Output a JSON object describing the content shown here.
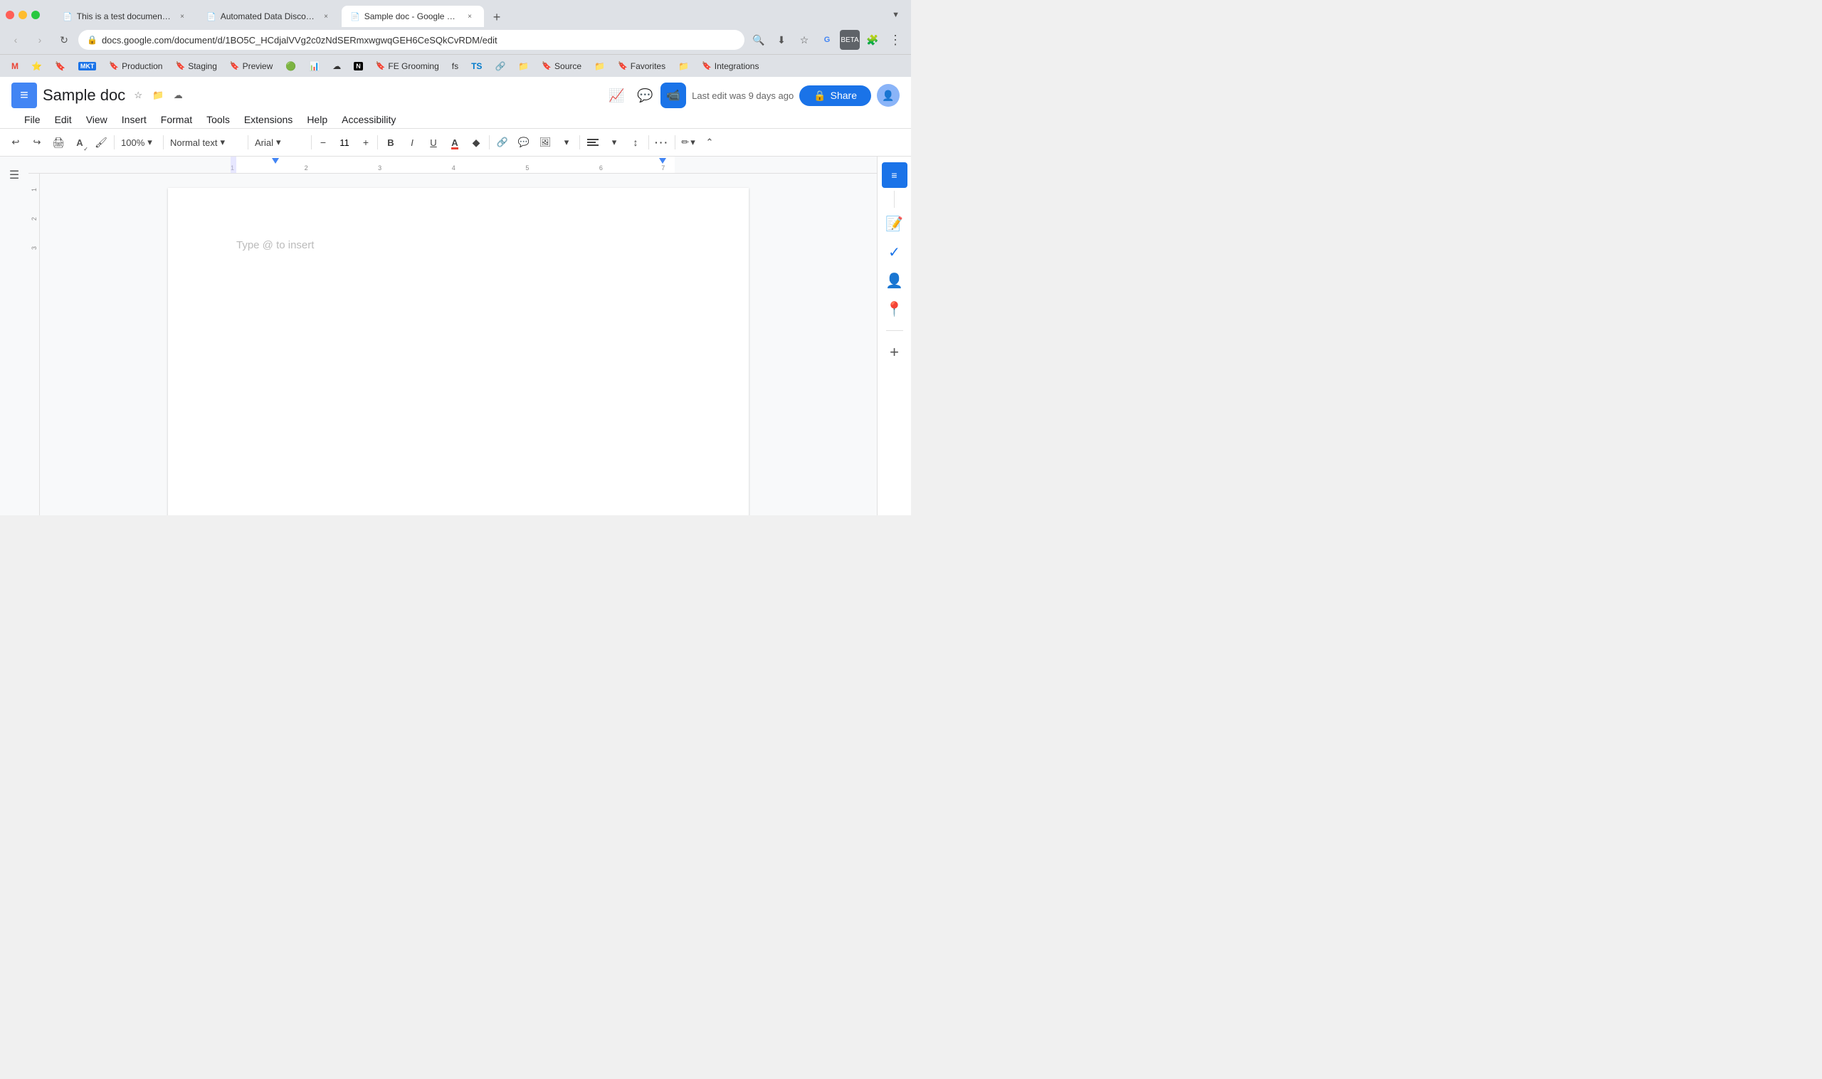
{
  "browser": {
    "tabs": [
      {
        "id": "tab1",
        "title": "This is a test document | Selec...",
        "icon": "📄",
        "active": false
      },
      {
        "id": "tab2",
        "title": "Automated Data Discovery | Fi...",
        "icon": "📄",
        "active": false
      },
      {
        "id": "tab3",
        "title": "Sample doc - Google Docs",
        "icon": "📄",
        "active": true
      }
    ],
    "url": "docs.google.com/document/d/1BO5C_HCdjalVVg2c0zNdSERmxwgwqGEH6CeSQkCvRDM/edit",
    "new_tab_label": "+",
    "nav": {
      "back": "‹",
      "forward": "›",
      "refresh": "↻"
    }
  },
  "bookmarks": [
    {
      "id": "bm-gmail",
      "label": "",
      "icon": "M"
    },
    {
      "id": "bm-star",
      "label": "",
      "icon": "★"
    },
    {
      "id": "bm-bookmark",
      "label": "",
      "icon": "🔖"
    },
    {
      "id": "bm-mkt",
      "label": "MKT",
      "icon": "M"
    },
    {
      "id": "bm-production",
      "label": "Production",
      "icon": "P"
    },
    {
      "id": "bm-staging",
      "label": "Staging",
      "icon": "S"
    },
    {
      "id": "bm-preview",
      "label": "Preview",
      "icon": "P"
    },
    {
      "id": "bm-icon1",
      "label": "",
      "icon": "🟢"
    },
    {
      "id": "bm-icon2",
      "label": "",
      "icon": "📊"
    },
    {
      "id": "bm-icon3",
      "label": "",
      "icon": "☁"
    },
    {
      "id": "bm-icon4",
      "label": "",
      "icon": "N"
    },
    {
      "id": "bm-fe",
      "label": "FE Grooming",
      "icon": "FE"
    },
    {
      "id": "bm-fs",
      "label": "",
      "icon": "fs"
    },
    {
      "id": "bm-ts",
      "label": "",
      "icon": "ts"
    },
    {
      "id": "bm-link",
      "label": "",
      "icon": "🔗"
    },
    {
      "id": "bm-folder",
      "label": "",
      "icon": "📁"
    },
    {
      "id": "bm-source",
      "label": "Source",
      "icon": "S"
    },
    {
      "id": "bm-folder2",
      "label": "",
      "icon": "📁"
    },
    {
      "id": "bm-favorites",
      "label": "Favorites",
      "icon": "★"
    },
    {
      "id": "bm-folder3",
      "label": "",
      "icon": "📁"
    },
    {
      "id": "bm-integrations",
      "label": "Integrations",
      "icon": "🔧"
    }
  ],
  "docs": {
    "title": "Sample doc",
    "last_edit": "Last edit was 9 days ago",
    "menu": {
      "items": [
        {
          "id": "file",
          "label": "File"
        },
        {
          "id": "edit",
          "label": "Edit"
        },
        {
          "id": "view",
          "label": "View"
        },
        {
          "id": "insert",
          "label": "Insert"
        },
        {
          "id": "format",
          "label": "Format"
        },
        {
          "id": "tools",
          "label": "Tools"
        },
        {
          "id": "extensions",
          "label": "Extensions"
        },
        {
          "id": "help",
          "label": "Help"
        },
        {
          "id": "accessibility",
          "label": "Accessibility"
        }
      ]
    },
    "toolbar": {
      "zoom": "100%",
      "style": "Normal text",
      "font": "Arial",
      "font_size": "11",
      "share_label": "Share"
    },
    "document": {
      "placeholder": "Type @ to insert"
    }
  }
}
